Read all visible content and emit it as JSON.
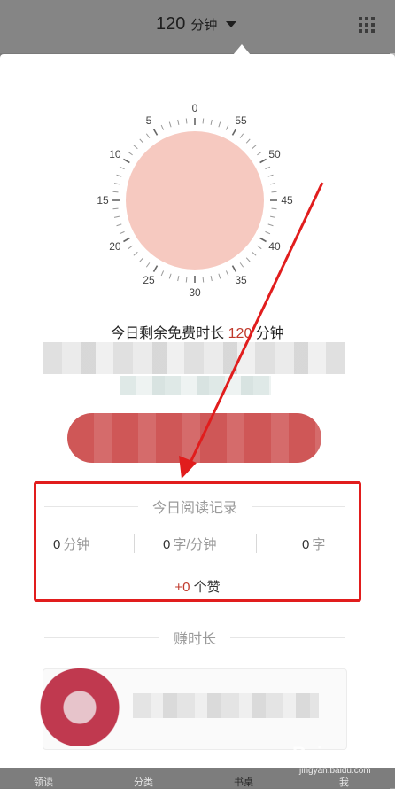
{
  "header": {
    "duration_value": "120",
    "duration_unit": "分钟",
    "menu_icon": "grid-icon",
    "dropdown_icon": "caret-down-icon"
  },
  "dial": {
    "tick_labels": [
      "0",
      "5",
      "10",
      "15",
      "20",
      "25",
      "30",
      "35",
      "40",
      "45",
      "50",
      "55"
    ],
    "fill_color": "#f6c9c0"
  },
  "remaining": {
    "prefix": "今日剩余免费时长",
    "value": "120",
    "unit": "分钟"
  },
  "today_record": {
    "title": "今日阅读记录",
    "minutes_value": "0",
    "minutes_unit": "分钟",
    "speed_value": "0",
    "speed_unit": "字/分钟",
    "words_value": "0",
    "words_unit": "字",
    "likes_value": "+0",
    "likes_unit": "个赞"
  },
  "earn": {
    "title": "赚时长"
  },
  "tabs": [
    {
      "label": "领读"
    },
    {
      "label": "分类"
    },
    {
      "label": "书桌"
    },
    {
      "label": "我"
    }
  ],
  "watermark": {
    "brand": "Bai",
    "site": "jingyan.baidu.com"
  },
  "colors": {
    "accent": "#c0392b",
    "annotation": "#e11d1d"
  }
}
